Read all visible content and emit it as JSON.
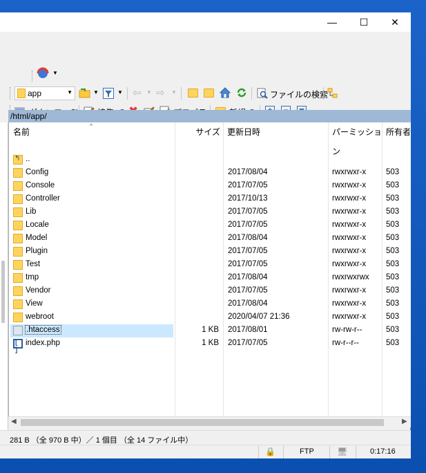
{
  "window": {
    "minimize_glyph": "—",
    "maximize_glyph": "☐",
    "close_glyph": "✕"
  },
  "toolbar1": {
    "folder_combo_value": "app",
    "find_files_label": "ファイルの検索"
  },
  "toolbar2": {
    "download_label": "ダウンロード",
    "edit_label": "編集",
    "properties_label": "プロパティ",
    "new_label": "新規"
  },
  "path": "/html/app/",
  "columns": {
    "name": "名前",
    "size": "サイズ",
    "modified": "更新日時",
    "permissions": "パーミッション",
    "owner": "所有者"
  },
  "files": [
    {
      "name": "..",
      "size": "",
      "modified": "",
      "perm": "",
      "owner": "",
      "type": "parent"
    },
    {
      "name": "Config",
      "size": "",
      "modified": "2017/08/04",
      "perm": "rwxrwxr-x",
      "owner": "503",
      "type": "folder"
    },
    {
      "name": "Console",
      "size": "",
      "modified": "2017/07/05",
      "perm": "rwxrwxr-x",
      "owner": "503",
      "type": "folder"
    },
    {
      "name": "Controller",
      "size": "",
      "modified": "2017/10/13",
      "perm": "rwxrwxr-x",
      "owner": "503",
      "type": "folder"
    },
    {
      "name": "Lib",
      "size": "",
      "modified": "2017/07/05",
      "perm": "rwxrwxr-x",
      "owner": "503",
      "type": "folder"
    },
    {
      "name": "Locale",
      "size": "",
      "modified": "2017/07/05",
      "perm": "rwxrwxr-x",
      "owner": "503",
      "type": "folder"
    },
    {
      "name": "Model",
      "size": "",
      "modified": "2017/08/04",
      "perm": "rwxrwxr-x",
      "owner": "503",
      "type": "folder"
    },
    {
      "name": "Plugin",
      "size": "",
      "modified": "2017/07/05",
      "perm": "rwxrwxr-x",
      "owner": "503",
      "type": "folder"
    },
    {
      "name": "Test",
      "size": "",
      "modified": "2017/07/05",
      "perm": "rwxrwxr-x",
      "owner": "503",
      "type": "folder"
    },
    {
      "name": "tmp",
      "size": "",
      "modified": "2017/08/04",
      "perm": "rwxrwxrwx",
      "owner": "503",
      "type": "folder"
    },
    {
      "name": "Vendor",
      "size": "",
      "modified": "2017/07/05",
      "perm": "rwxrwxr-x",
      "owner": "503",
      "type": "folder"
    },
    {
      "name": "View",
      "size": "",
      "modified": "2017/08/04",
      "perm": "rwxrwxr-x",
      "owner": "503",
      "type": "folder"
    },
    {
      "name": "webroot",
      "size": "",
      "modified": "2020/04/07 21:36",
      "perm": "rwxrwxr-x",
      "owner": "503",
      "type": "folder"
    },
    {
      "name": ".htaccess",
      "size": "1 KB",
      "modified": "2017/08/01",
      "perm": "rw-rw-r--",
      "owner": "503",
      "type": "file",
      "selected": true
    },
    {
      "name": "index.php",
      "size": "1 KB",
      "modified": "2017/07/05",
      "perm": "rw-r--r--",
      "owner": "503",
      "type": "php"
    }
  ],
  "status": {
    "summary": "281 B （全 970 B 中）／ 1 個目 （全 14 ファイル中）",
    "protocol": "FTP",
    "time": "0:17:16"
  },
  "colors": {
    "path_bar": "#9fb8d6",
    "selection": "#cce8ff",
    "folder": "#ffd45e",
    "desktop": "#0b4fb0"
  }
}
